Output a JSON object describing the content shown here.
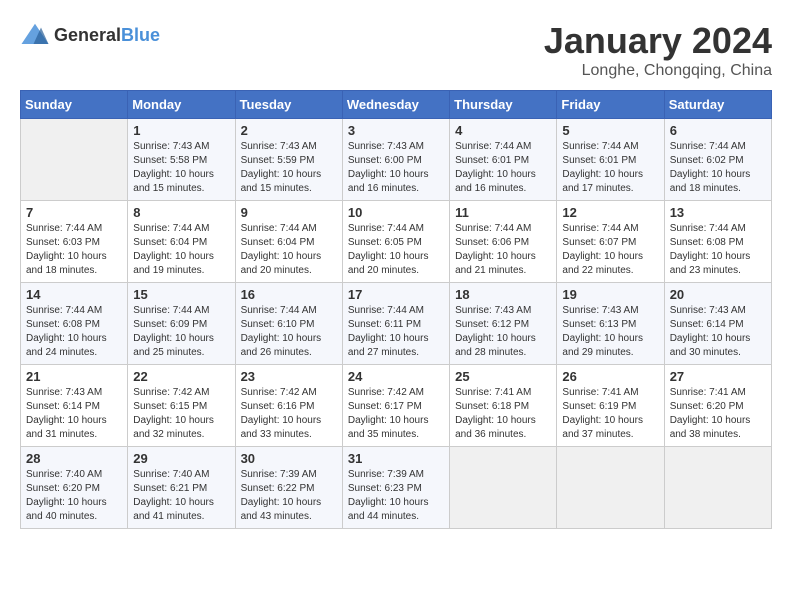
{
  "header": {
    "logo_general": "General",
    "logo_blue": "Blue",
    "title": "January 2024",
    "subtitle": "Longhe, Chongqing, China"
  },
  "days_of_week": [
    "Sunday",
    "Monday",
    "Tuesday",
    "Wednesday",
    "Thursday",
    "Friday",
    "Saturday"
  ],
  "weeks": [
    [
      {
        "day": "",
        "content": ""
      },
      {
        "day": "1",
        "content": "Sunrise: 7:43 AM\nSunset: 5:58 PM\nDaylight: 10 hours\nand 15 minutes."
      },
      {
        "day": "2",
        "content": "Sunrise: 7:43 AM\nSunset: 5:59 PM\nDaylight: 10 hours\nand 15 minutes."
      },
      {
        "day": "3",
        "content": "Sunrise: 7:43 AM\nSunset: 6:00 PM\nDaylight: 10 hours\nand 16 minutes."
      },
      {
        "day": "4",
        "content": "Sunrise: 7:44 AM\nSunset: 6:01 PM\nDaylight: 10 hours\nand 16 minutes."
      },
      {
        "day": "5",
        "content": "Sunrise: 7:44 AM\nSunset: 6:01 PM\nDaylight: 10 hours\nand 17 minutes."
      },
      {
        "day": "6",
        "content": "Sunrise: 7:44 AM\nSunset: 6:02 PM\nDaylight: 10 hours\nand 18 minutes."
      }
    ],
    [
      {
        "day": "7",
        "content": "Sunrise: 7:44 AM\nSunset: 6:03 PM\nDaylight: 10 hours\nand 18 minutes."
      },
      {
        "day": "8",
        "content": "Sunrise: 7:44 AM\nSunset: 6:04 PM\nDaylight: 10 hours\nand 19 minutes."
      },
      {
        "day": "9",
        "content": "Sunrise: 7:44 AM\nSunset: 6:04 PM\nDaylight: 10 hours\nand 20 minutes."
      },
      {
        "day": "10",
        "content": "Sunrise: 7:44 AM\nSunset: 6:05 PM\nDaylight: 10 hours\nand 20 minutes."
      },
      {
        "day": "11",
        "content": "Sunrise: 7:44 AM\nSunset: 6:06 PM\nDaylight: 10 hours\nand 21 minutes."
      },
      {
        "day": "12",
        "content": "Sunrise: 7:44 AM\nSunset: 6:07 PM\nDaylight: 10 hours\nand 22 minutes."
      },
      {
        "day": "13",
        "content": "Sunrise: 7:44 AM\nSunset: 6:08 PM\nDaylight: 10 hours\nand 23 minutes."
      }
    ],
    [
      {
        "day": "14",
        "content": "Sunrise: 7:44 AM\nSunset: 6:08 PM\nDaylight: 10 hours\nand 24 minutes."
      },
      {
        "day": "15",
        "content": "Sunrise: 7:44 AM\nSunset: 6:09 PM\nDaylight: 10 hours\nand 25 minutes."
      },
      {
        "day": "16",
        "content": "Sunrise: 7:44 AM\nSunset: 6:10 PM\nDaylight: 10 hours\nand 26 minutes."
      },
      {
        "day": "17",
        "content": "Sunrise: 7:44 AM\nSunset: 6:11 PM\nDaylight: 10 hours\nand 27 minutes."
      },
      {
        "day": "18",
        "content": "Sunrise: 7:43 AM\nSunset: 6:12 PM\nDaylight: 10 hours\nand 28 minutes."
      },
      {
        "day": "19",
        "content": "Sunrise: 7:43 AM\nSunset: 6:13 PM\nDaylight: 10 hours\nand 29 minutes."
      },
      {
        "day": "20",
        "content": "Sunrise: 7:43 AM\nSunset: 6:14 PM\nDaylight: 10 hours\nand 30 minutes."
      }
    ],
    [
      {
        "day": "21",
        "content": "Sunrise: 7:43 AM\nSunset: 6:14 PM\nDaylight: 10 hours\nand 31 minutes."
      },
      {
        "day": "22",
        "content": "Sunrise: 7:42 AM\nSunset: 6:15 PM\nDaylight: 10 hours\nand 32 minutes."
      },
      {
        "day": "23",
        "content": "Sunrise: 7:42 AM\nSunset: 6:16 PM\nDaylight: 10 hours\nand 33 minutes."
      },
      {
        "day": "24",
        "content": "Sunrise: 7:42 AM\nSunset: 6:17 PM\nDaylight: 10 hours\nand 35 minutes."
      },
      {
        "day": "25",
        "content": "Sunrise: 7:41 AM\nSunset: 6:18 PM\nDaylight: 10 hours\nand 36 minutes."
      },
      {
        "day": "26",
        "content": "Sunrise: 7:41 AM\nSunset: 6:19 PM\nDaylight: 10 hours\nand 37 minutes."
      },
      {
        "day": "27",
        "content": "Sunrise: 7:41 AM\nSunset: 6:20 PM\nDaylight: 10 hours\nand 38 minutes."
      }
    ],
    [
      {
        "day": "28",
        "content": "Sunrise: 7:40 AM\nSunset: 6:20 PM\nDaylight: 10 hours\nand 40 minutes."
      },
      {
        "day": "29",
        "content": "Sunrise: 7:40 AM\nSunset: 6:21 PM\nDaylight: 10 hours\nand 41 minutes."
      },
      {
        "day": "30",
        "content": "Sunrise: 7:39 AM\nSunset: 6:22 PM\nDaylight: 10 hours\nand 43 minutes."
      },
      {
        "day": "31",
        "content": "Sunrise: 7:39 AM\nSunset: 6:23 PM\nDaylight: 10 hours\nand 44 minutes."
      },
      {
        "day": "",
        "content": ""
      },
      {
        "day": "",
        "content": ""
      },
      {
        "day": "",
        "content": ""
      }
    ]
  ]
}
